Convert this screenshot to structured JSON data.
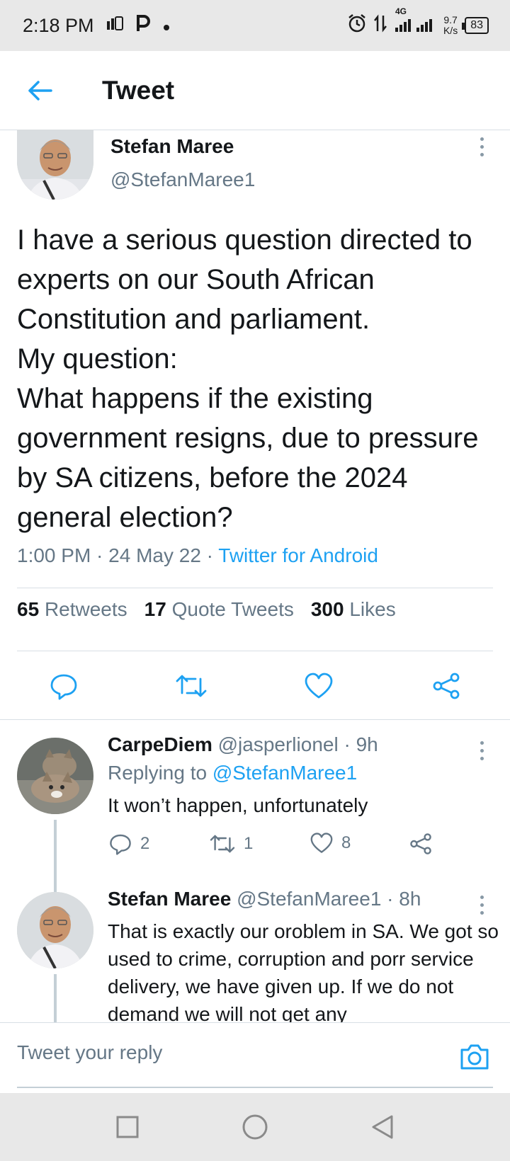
{
  "status_bar": {
    "time": "2:18 PM",
    "network_type": "4G",
    "speed_value": "9.7",
    "speed_unit": "K/s",
    "battery": "83",
    "icons": [
      "sim-icon",
      "p-icon",
      "dot-icon",
      "alarm-icon",
      "data-arrows-icon",
      "signal-icon",
      "battery-icon"
    ]
  },
  "header": {
    "title": "Tweet",
    "back_icon": "arrow-left-icon"
  },
  "tweet": {
    "author_name": "Stefan Maree",
    "author_handle": "@StefanMaree1",
    "text": "I have a serious question directed to experts on our South African Constitution and parliament.\nMy question:\nWhat happens if the existing government resigns, due to pressure by SA citizens, before the 2024 general election?",
    "time_date": "1:00 PM · 24 May 22 · ",
    "source": "Twitter for Android",
    "stats": {
      "retweets_count": "65",
      "retweets_label": "Retweets",
      "quotes_count": "17",
      "quotes_label": "Quote Tweets",
      "likes_count": "300",
      "likes_label": "Likes"
    }
  },
  "replies": [
    {
      "name": "CarpeDiem",
      "handle_time": " @jasperlionel · 9h",
      "replying_label": "Replying to ",
      "replying_to": "@StefanMaree1",
      "text": "It won’t happen, unfortunately",
      "reply_count": "2",
      "retweet_count": "1",
      "like_count": "8"
    },
    {
      "name": "Stefan Maree",
      "handle_time": " @StefanMaree1 · 8h",
      "text": "That is exactly our oroblem in SA. We got so used to crime, corruption and porr service delivery, we have given up. If we do not demand  we will not get any"
    }
  ],
  "reply_box": {
    "placeholder": "Tweet your reply"
  },
  "colors": {
    "accent": "#1da1f2",
    "secondary_text": "#657786",
    "primary_text": "#14171a",
    "divider": "#d8dfe5"
  }
}
